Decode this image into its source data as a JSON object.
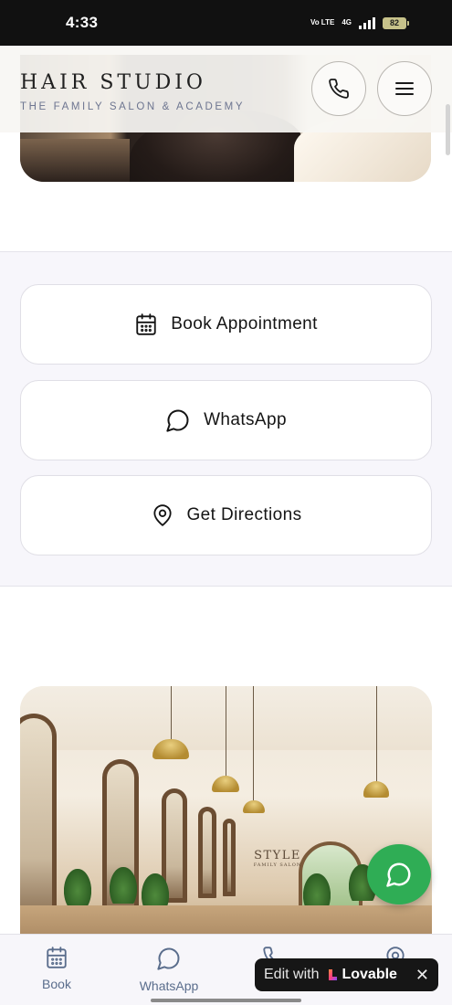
{
  "status_bar": {
    "time": "4:33",
    "network": "Vo LTE",
    "data": "4G",
    "battery": "82"
  },
  "header": {
    "title": "HAIR STUDIO",
    "subtitle": "THE FAMILY SALON & ACADEMY",
    "call_icon": "phone-icon",
    "menu_icon": "hamburger-menu-icon"
  },
  "actions": [
    {
      "label": "Book Appointment",
      "icon": "calendar-icon"
    },
    {
      "label": "WhatsApp",
      "icon": "chat-bubble-icon"
    },
    {
      "label": "Get Directions",
      "icon": "map-pin-icon"
    }
  ],
  "interior_sign": {
    "main": "STYLE",
    "sub": "FAMILY SALON"
  },
  "fab": {
    "icon": "whatsapp-icon",
    "color": "#2fad55"
  },
  "bottom_nav": [
    {
      "label": "Book",
      "icon": "calendar-icon"
    },
    {
      "label": "WhatsApp",
      "icon": "chat-bubble-icon"
    },
    {
      "label": "",
      "icon": "phone-icon"
    },
    {
      "label": "",
      "icon": "map-pin-icon"
    }
  ],
  "edit_badge": {
    "prefix": "Edit with",
    "brand": "Lovable",
    "close": "✕"
  },
  "colors": {
    "accent_green": "#2fad55",
    "nav_text": "#5a6d8c",
    "header_sub": "#6d7590"
  }
}
